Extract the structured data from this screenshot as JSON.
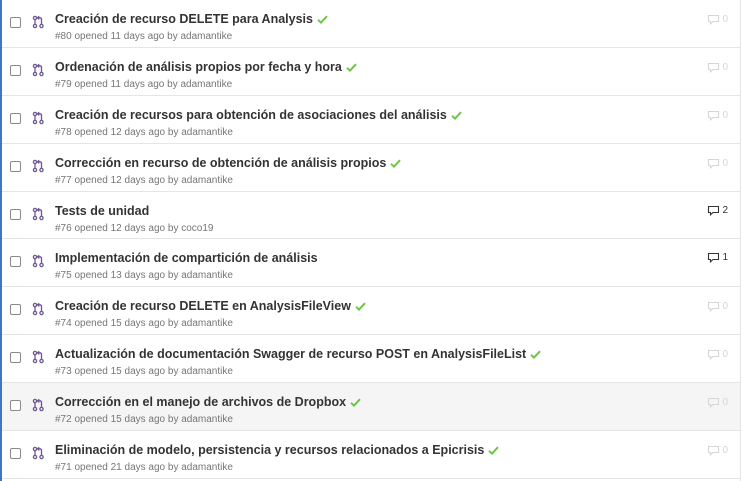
{
  "pulls": [
    {
      "title": "Creación de recurso DELETE para Analysis",
      "meta": "#80 opened 11 days ago by adamantike",
      "comments": "0",
      "check": true
    },
    {
      "title": "Ordenación de análisis propios por fecha y hora",
      "meta": "#79 opened 11 days ago by adamantike",
      "comments": "0",
      "check": true
    },
    {
      "title": "Creación de recursos para obtención de asociaciones del análisis",
      "meta": "#78 opened 12 days ago by adamantike",
      "comments": "0",
      "check": true
    },
    {
      "title": "Corrección en recurso de obtención de análisis propios",
      "meta": "#77 opened 12 days ago by adamantike",
      "comments": "0",
      "check": true
    },
    {
      "title": "Tests de unidad",
      "meta": "#76 opened 12 days ago by coco19",
      "comments": "2",
      "check": false
    },
    {
      "title": "Implementación de compartición de análisis",
      "meta": "#75 opened 13 days ago by adamantike",
      "comments": "1",
      "check": false
    },
    {
      "title": "Creación de recurso DELETE en AnalysisFileView",
      "meta": "#74 opened 15 days ago by adamantike",
      "comments": "0",
      "check": true
    },
    {
      "title": "Actualización de documentación Swagger de recurso POST en AnalysisFileList",
      "meta": "#73 opened 15 days ago by adamantike",
      "comments": "0",
      "check": true
    },
    {
      "title": "Corrección en el manejo de archivos de Dropbox",
      "meta": "#72 opened 15 days ago by adamantike",
      "comments": "0",
      "check": true
    },
    {
      "title": "Eliminación de modelo, persistencia y recursos relacionados a Epicrisis",
      "meta": "#71 opened 21 days ago by adamantike",
      "comments": "0",
      "check": true
    }
  ],
  "icons": {
    "row_icon": "git-pull-request-icon",
    "status_icon": "check-icon",
    "comment_icon": "comment-icon"
  },
  "colors": {
    "accent_border": "#4078c0",
    "success": "#6cc644",
    "title": "#333333",
    "meta": "#767676"
  },
  "hovered_row": 8
}
